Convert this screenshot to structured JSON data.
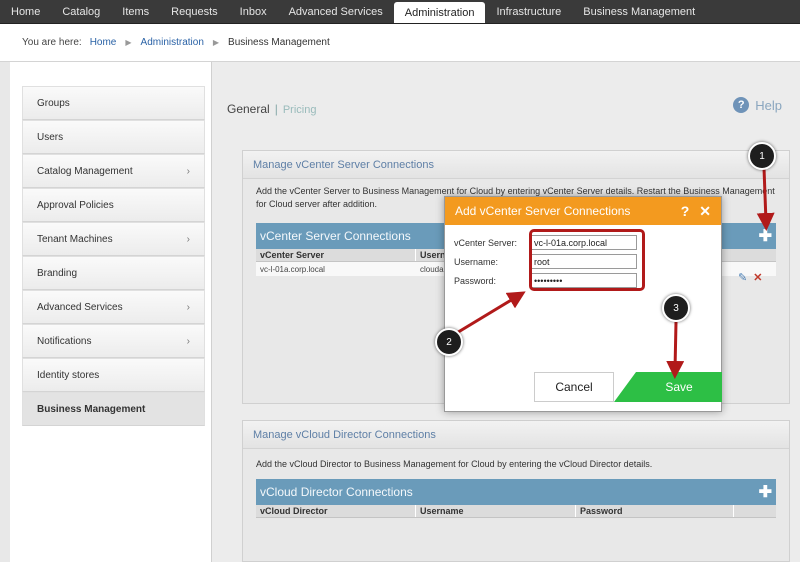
{
  "nav": {
    "tabs": [
      "Home",
      "Catalog",
      "Items",
      "Requests",
      "Inbox",
      "Advanced Services",
      "Administration",
      "Infrastructure",
      "Business Management"
    ],
    "active_index": 6
  },
  "breadcrumb": {
    "label": "You are here:",
    "items": [
      "Home",
      "Administration",
      "Business Management"
    ]
  },
  "sidebar": {
    "items": [
      {
        "label": "Groups",
        "has_children": false
      },
      {
        "label": "Users",
        "has_children": false
      },
      {
        "label": "Catalog Management",
        "has_children": true
      },
      {
        "label": "Approval Policies",
        "has_children": false
      },
      {
        "label": "Tenant Machines",
        "has_children": true
      },
      {
        "label": "Branding",
        "has_children": false
      },
      {
        "label": "Advanced Services",
        "has_children": true
      },
      {
        "label": "Notifications",
        "has_children": true
      },
      {
        "label": "Identity stores",
        "has_children": false
      },
      {
        "label": "Business Management",
        "has_children": false,
        "active": true
      }
    ]
  },
  "main": {
    "subtab_general": "General",
    "subtab_divider": "|",
    "subtab_pricing": "Pricing",
    "help_label": "Help",
    "help_icon_glyph": "?",
    "vcenter_panel": {
      "title": "Manage vCenter Server Connections",
      "description": "Add the vCenter Server to Business Management for Cloud by entering vCenter Server details. Restart the Business Management for Cloud server after addition.",
      "grid_title": "vCenter Server Connections",
      "columns": [
        "vCenter Server",
        "Username"
      ],
      "rows": [
        [
          "vc-l-01a.corp.local",
          "clouda"
        ]
      ]
    },
    "vcloud_panel": {
      "title": "Manage vCloud Director Connections",
      "description": "Add the vCloud Director to Business Management for Cloud by entering the vCloud Director details.",
      "grid_title": "vCloud Director Connections",
      "columns": [
        "vCloud Director",
        "Username",
        "Password"
      ]
    }
  },
  "dialog": {
    "title": "Add vCenter Server Connections",
    "help_glyph": "?",
    "close_glyph": "✕",
    "fields": [
      {
        "label": "vCenter Server:",
        "value": "vc-l-01a.corp.local"
      },
      {
        "label": "Username:",
        "value": "root"
      },
      {
        "label": "Password:",
        "value": "•••••••••"
      }
    ],
    "cancel_label": "Cancel",
    "save_label": "Save"
  },
  "callouts": [
    "1",
    "2",
    "3"
  ],
  "colors": {
    "accent_orange": "#f39a1f",
    "save_green": "#2dbf45",
    "grid_header": "#6a9bba",
    "annotation_red": "#b11a1a"
  }
}
